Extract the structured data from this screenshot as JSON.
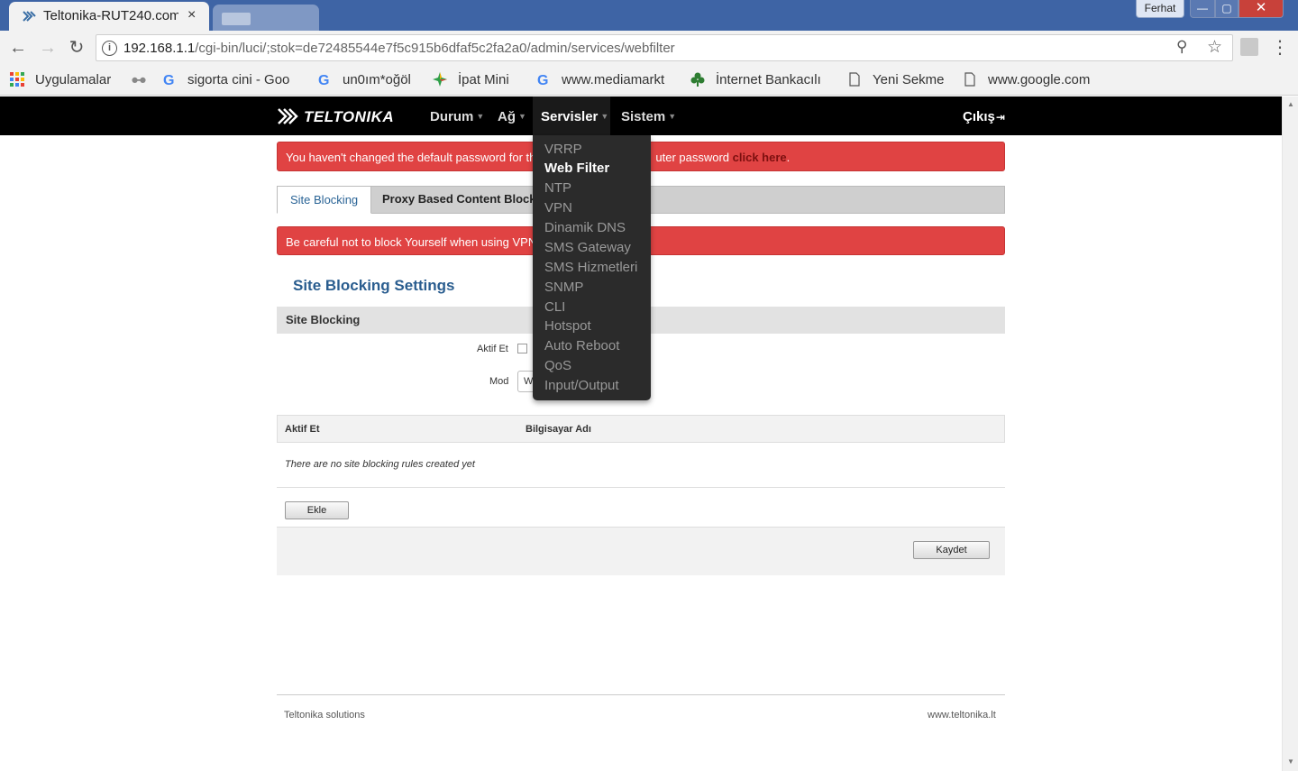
{
  "browser": {
    "tab_title": "Teltonika-RUT240.com",
    "tab_close": "×",
    "user_label": "Ferhat",
    "win_min": "—",
    "win_max": "▢",
    "win_close": "✕",
    "back_icon": "arrow-left-icon",
    "url_host": "192.168.1.1",
    "url_path": "/cgi-bin/luci/;stok=de72485544e7f5c915b6dfaf5c2fa2a0/admin/services/webfilter",
    "bookmarks": [
      {
        "label": "Uygulamalar"
      },
      {
        "label": "sigorta cini - Goo"
      },
      {
        "label": "un0ım*oğöl"
      },
      {
        "label": "İpat Mini"
      },
      {
        "label": "www.mediamarkt"
      },
      {
        "label": "İnternet Bankacılı"
      },
      {
        "label": "Yeni Sekme"
      },
      {
        "label": "www.google.com"
      }
    ]
  },
  "router": {
    "logo_text": "TELTONIKA",
    "nav": {
      "durum": "Durum",
      "ag": "Ağ",
      "servisler": "Servisler",
      "sistem": "Sistem",
      "logout": "Çıkış"
    },
    "dropdown": [
      "VRRP",
      "Web Filter",
      "NTP",
      "VPN",
      "Dinamik DNS",
      "SMS Gateway",
      "SMS Hizmetleri",
      "SNMP",
      "CLI",
      "Hotspot",
      "Auto Reboot",
      "QoS",
      "Input/Output"
    ],
    "alert_password_prefix": "You haven't changed the default password for th",
    "alert_password_suffix": "uter password ",
    "alert_password_link": "click here",
    "tabs": {
      "site_blocking": "Site Blocking",
      "proxy": "Proxy Based Content Blocker"
    },
    "alert_vpn": "Be careful not to block Yourself when using VPN",
    "section_title": "Site Blocking Settings",
    "section_bar": "Site Blocking",
    "enable_label": "Aktif Et",
    "mode_label": "Mod",
    "mode_value": "Whitelist",
    "table": {
      "col_enable": "Aktif Et",
      "col_host": "Bilgisayar Adı",
      "empty": "There are no site blocking rules created yet"
    },
    "add_button": "Ekle",
    "save_button": "Kaydet",
    "footer_left": "Teltonika solutions",
    "footer_right": "www.teltonika.lt"
  }
}
